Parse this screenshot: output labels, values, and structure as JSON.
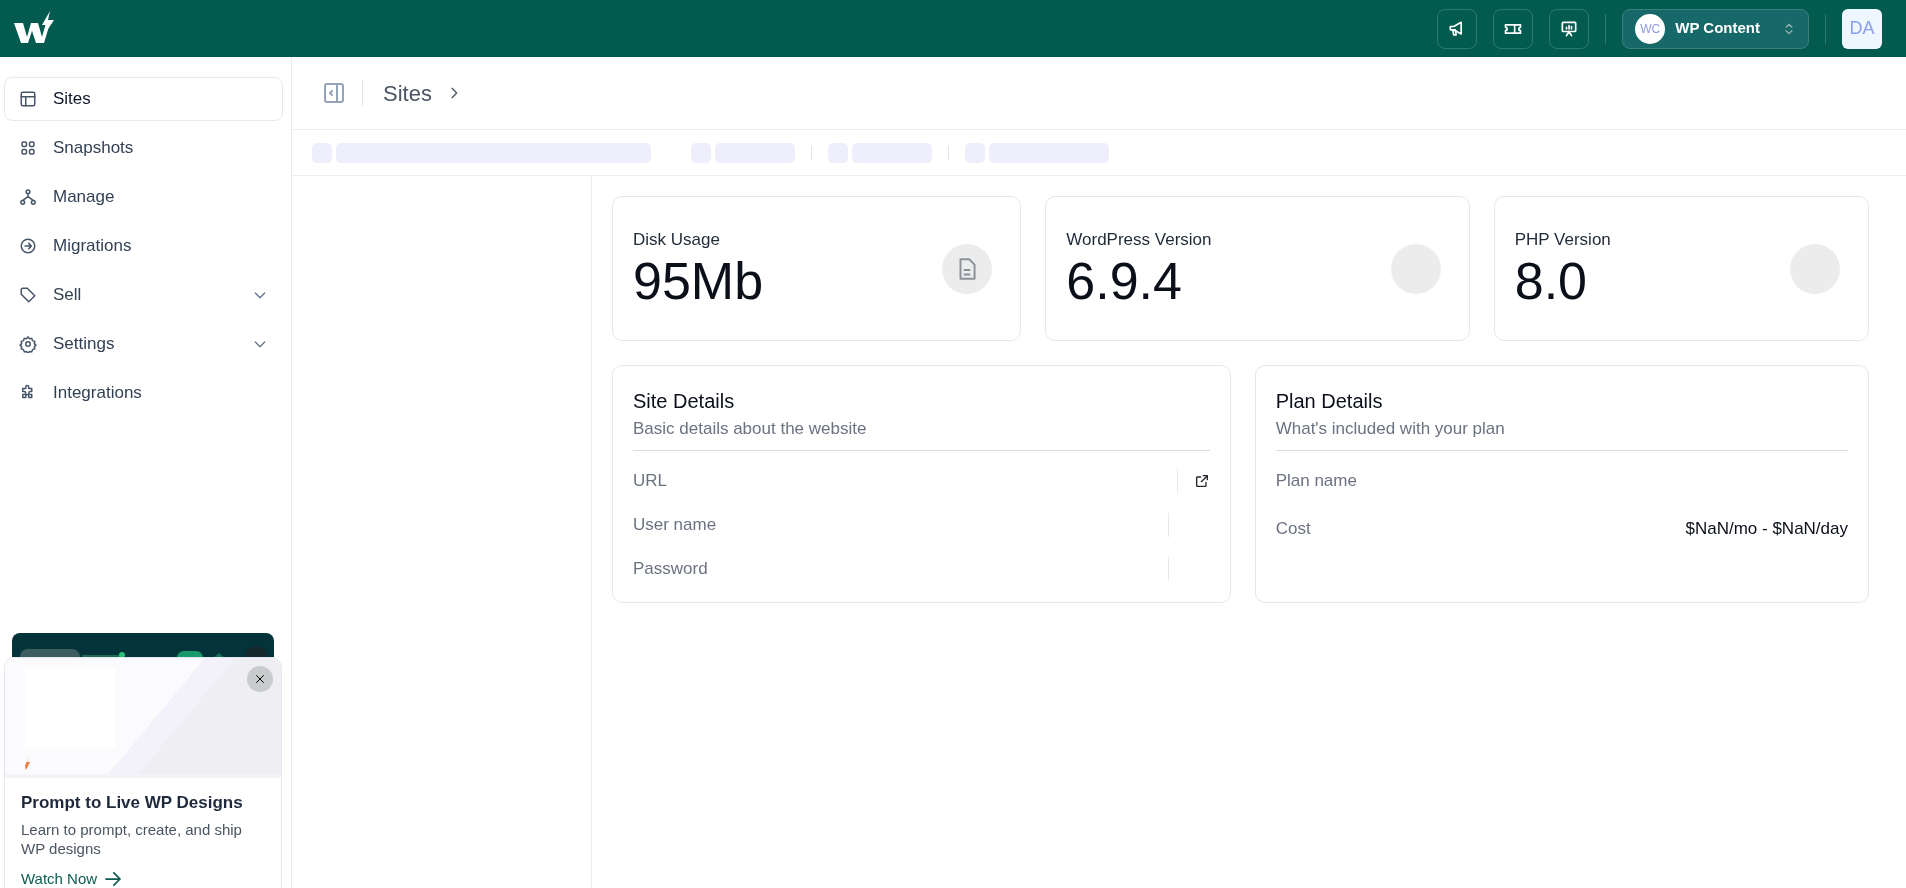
{
  "topbar": {
    "workspace": {
      "initials": "WC",
      "name": "WP Content"
    },
    "user": {
      "initials": "DA"
    }
  },
  "sidebar": {
    "items": [
      {
        "label": "Sites",
        "selected": true,
        "expandable": false
      },
      {
        "label": "Snapshots",
        "selected": false,
        "expandable": false
      },
      {
        "label": "Manage",
        "selected": false,
        "expandable": false
      },
      {
        "label": "Migrations",
        "selected": false,
        "expandable": false
      },
      {
        "label": "Sell",
        "selected": false,
        "expandable": true
      },
      {
        "label": "Settings",
        "selected": false,
        "expandable": true
      },
      {
        "label": "Integrations",
        "selected": false,
        "expandable": false
      }
    ]
  },
  "promo": {
    "title": "Prompt to Live WP Designs",
    "description": "Learn to prompt, create, and ship WP designs",
    "link": "Watch Now"
  },
  "breadcrumb": {
    "items": [
      "Sites"
    ]
  },
  "stats": [
    {
      "label": "Disk Usage",
      "value": "95Mb",
      "kind": "file"
    },
    {
      "label": "WordPress Version",
      "value": "6.9.4",
      "kind": "blank"
    },
    {
      "label": "PHP Version",
      "value": "8.0",
      "kind": "blank"
    }
  ],
  "site_details": {
    "title": "Site Details",
    "subtitle": "Basic details about the website",
    "rows": [
      {
        "label": "URL",
        "kind": "link"
      },
      {
        "label": "User name",
        "kind": "copy"
      },
      {
        "label": "Password",
        "kind": "copy"
      }
    ]
  },
  "plan_details": {
    "title": "Plan Details",
    "subtitle": "What's included with your plan",
    "rows": [
      {
        "label": "Plan name"
      },
      {
        "label": "Cost",
        "value": "$NaN/mo - $NaN/day"
      }
    ]
  }
}
